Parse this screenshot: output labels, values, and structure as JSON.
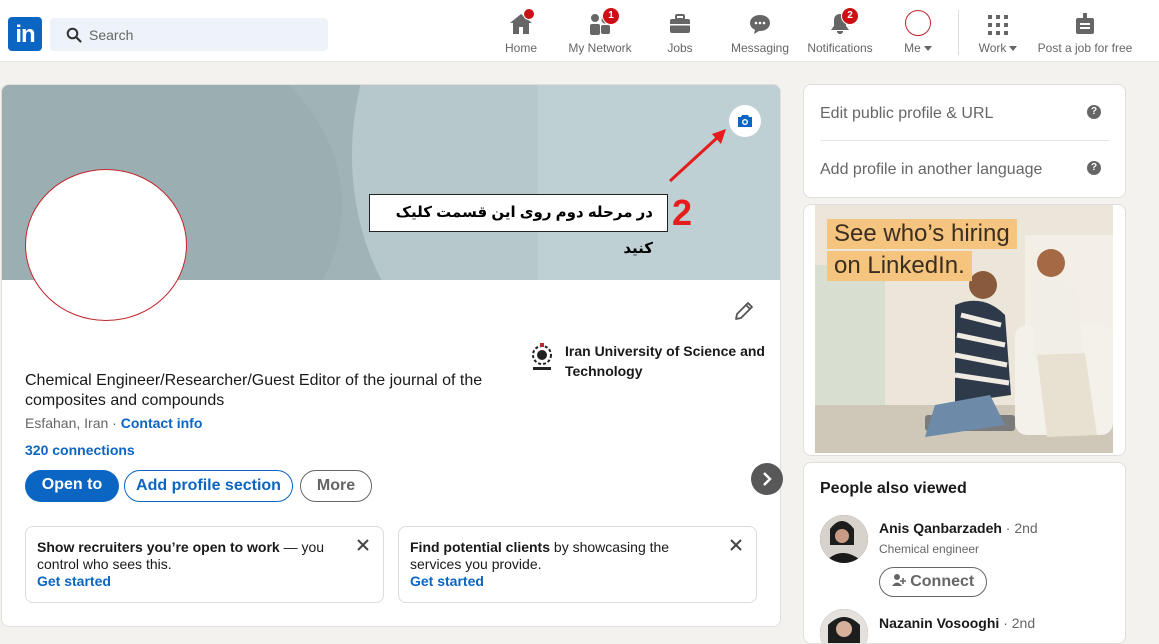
{
  "nav": {
    "search_placeholder": "Search",
    "items": [
      {
        "label": "Home",
        "icon": "home-icon",
        "badge": ""
      },
      {
        "label": "My Network",
        "icon": "network-icon",
        "badge": "1"
      },
      {
        "label": "Jobs",
        "icon": "briefcase-icon",
        "badge": ""
      },
      {
        "label": "Messaging",
        "icon": "messaging-icon",
        "badge": ""
      },
      {
        "label": "Notifications",
        "icon": "bell-icon",
        "badge": "2"
      },
      {
        "label": "Me",
        "icon": "avatar-icon",
        "badge": ""
      },
      {
        "label": "Work",
        "icon": "grid-icon",
        "badge": ""
      },
      {
        "label": "Post a job for free",
        "icon": "post-job-icon",
        "badge": ""
      }
    ],
    "logo_text": "in"
  },
  "profile": {
    "headline": "Chemical Engineer/Researcher/Guest Editor of the journal of the composites and compounds",
    "location": "Esfahan, Iran",
    "location_sep": " · ",
    "contact_info": "Contact info",
    "connections": "320 connections",
    "university": "Iran University of Science and Technology",
    "buttons": {
      "open_to": "Open to",
      "add_section": "Add profile section",
      "more": "More"
    },
    "annotation_text": "در مرحله دوم روی این قسمت کلیک کنید",
    "annotation_number": "2"
  },
  "cards": [
    {
      "bold": "Show recruiters you’re open to work",
      "rest": " — you control who sees this.",
      "link": "Get started"
    },
    {
      "bold": "Find potential clients",
      "rest": " by showcasing the services you provide.",
      "link": "Get started"
    }
  ],
  "sidebar": {
    "links": [
      "Edit public profile & URL",
      "Add profile in another language"
    ],
    "ad_lines": [
      "See who’s hiring",
      "on LinkedIn."
    ],
    "people_title": "People also viewed",
    "people": [
      {
        "name": "Anis Qanbarzadeh",
        "degree": " · 2nd",
        "title": "Chemical engineer",
        "action": "Connect"
      },
      {
        "name": "Nazanin Vosooghi",
        "degree": " · 2nd",
        "title": "",
        "action": ""
      }
    ]
  },
  "colors": {
    "brand": "#0a66c2",
    "badge": "#cc1016",
    "annotation_red": "#e51c1c"
  }
}
